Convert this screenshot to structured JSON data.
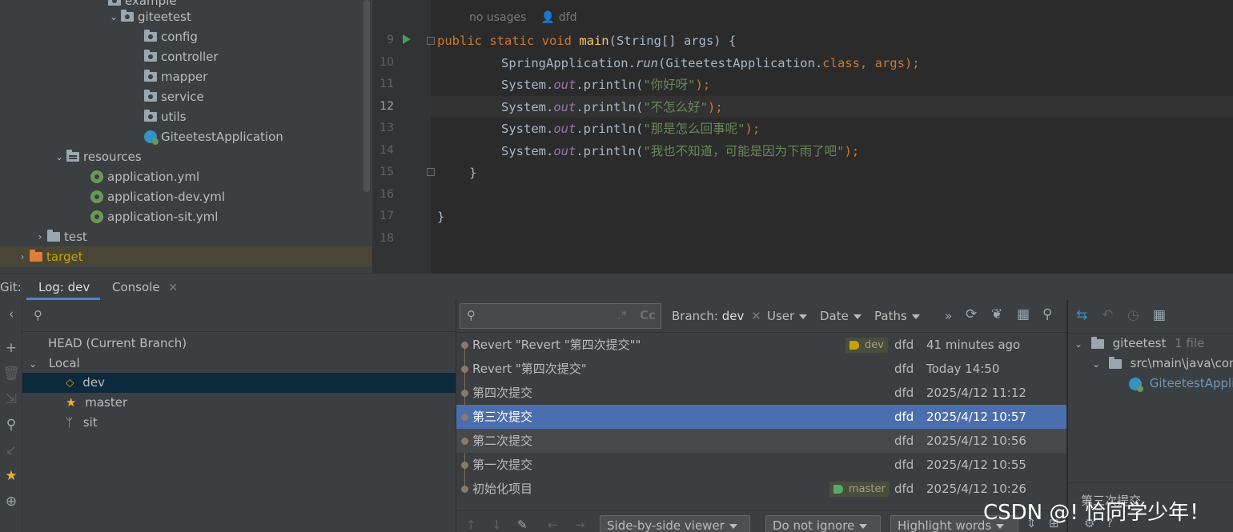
{
  "project_tree": {
    "items": [
      {
        "label": "example",
        "depth": 5
      },
      {
        "label": "giteetest"
      },
      {
        "label": "config"
      },
      {
        "label": "controller"
      },
      {
        "label": "mapper"
      },
      {
        "label": "service"
      },
      {
        "label": "utils"
      },
      {
        "label": "GiteetestApplication"
      },
      {
        "label": "resources"
      },
      {
        "label": "application.yml"
      },
      {
        "label": "application-dev.yml"
      },
      {
        "label": "application-sit.yml"
      },
      {
        "label": "test"
      },
      {
        "label": "target"
      }
    ]
  },
  "editor": {
    "hint_usages": "no usages",
    "hint_author": "dfd",
    "line_numbers": [
      "9",
      "10",
      "11",
      "12",
      "13",
      "14",
      "15",
      "16",
      "17",
      "18"
    ],
    "current_line": "12",
    "code": {
      "l9_kw": "public static void ",
      "l9_fn": "main",
      "l9_rest": "(String[] args) {",
      "l10_a": "SpringApplication.",
      "l10_run": "run",
      "l10_b": "(GiteetestApplication.",
      "l10_class": "class",
      "l10_c": ", args);",
      "print_prefix": "System.",
      "print_out": "out",
      "print_fn": ".println(",
      "str1": "\"你好呀\"",
      "str2": "\"不怎么好\"",
      "str3": "\"那是怎么回事呢\"",
      "str4": "\"我也不知道，可能是因为下雨了吧\"",
      "close": ");",
      "brace_inner": "}",
      "brace_outer": "}"
    }
  },
  "tool_window": {
    "git_label": "Git:",
    "tab_log": "Log: dev",
    "tab_console": "Console"
  },
  "branches": {
    "head": "HEAD (Current Branch)",
    "local": "Local",
    "items": [
      "dev",
      "master",
      "sit"
    ],
    "selected": "dev"
  },
  "log": {
    "filters": {
      "branch_label": "Branch: ",
      "branch_value": "dev",
      "user": "User",
      "date": "Date",
      "paths": "Paths",
      "cc": "Cc"
    },
    "commits": [
      {
        "message": "Revert \"Revert \"第四次提交\"\"",
        "tag": "dev",
        "author": "dfd",
        "date": "41 minutes ago"
      },
      {
        "message": "Revert \"第四次提交\"",
        "tag": "",
        "author": "dfd",
        "date": "Today 14:50"
      },
      {
        "message": "第四次提交",
        "tag": "",
        "author": "dfd",
        "date": "2025/4/12 11:12"
      },
      {
        "message": "第三次提交",
        "tag": "",
        "author": "dfd",
        "date": "2025/4/12 10:57"
      },
      {
        "message": "第二次提交",
        "tag": "",
        "author": "dfd",
        "date": "2025/4/12 10:56"
      },
      {
        "message": "第一次提交",
        "tag": "",
        "author": "dfd",
        "date": "2025/4/12 10:55"
      },
      {
        "message": "初始化项目",
        "tag": "master",
        "author": "dfd",
        "date": "2025/4/12 10:26"
      }
    ],
    "selected_index": 3,
    "bottom": {
      "viewer": "Side-by-side viewer",
      "ignore": "Do not ignore",
      "highlight": "Highlight words"
    }
  },
  "changes": {
    "root": "giteetest",
    "root_count": "1 file",
    "path": "src\\main\\java\\com",
    "file": "GiteetestApplic",
    "commit_msg_preview": "第三次提交"
  },
  "watermark": "CSDN @! 恰同学少年！"
}
